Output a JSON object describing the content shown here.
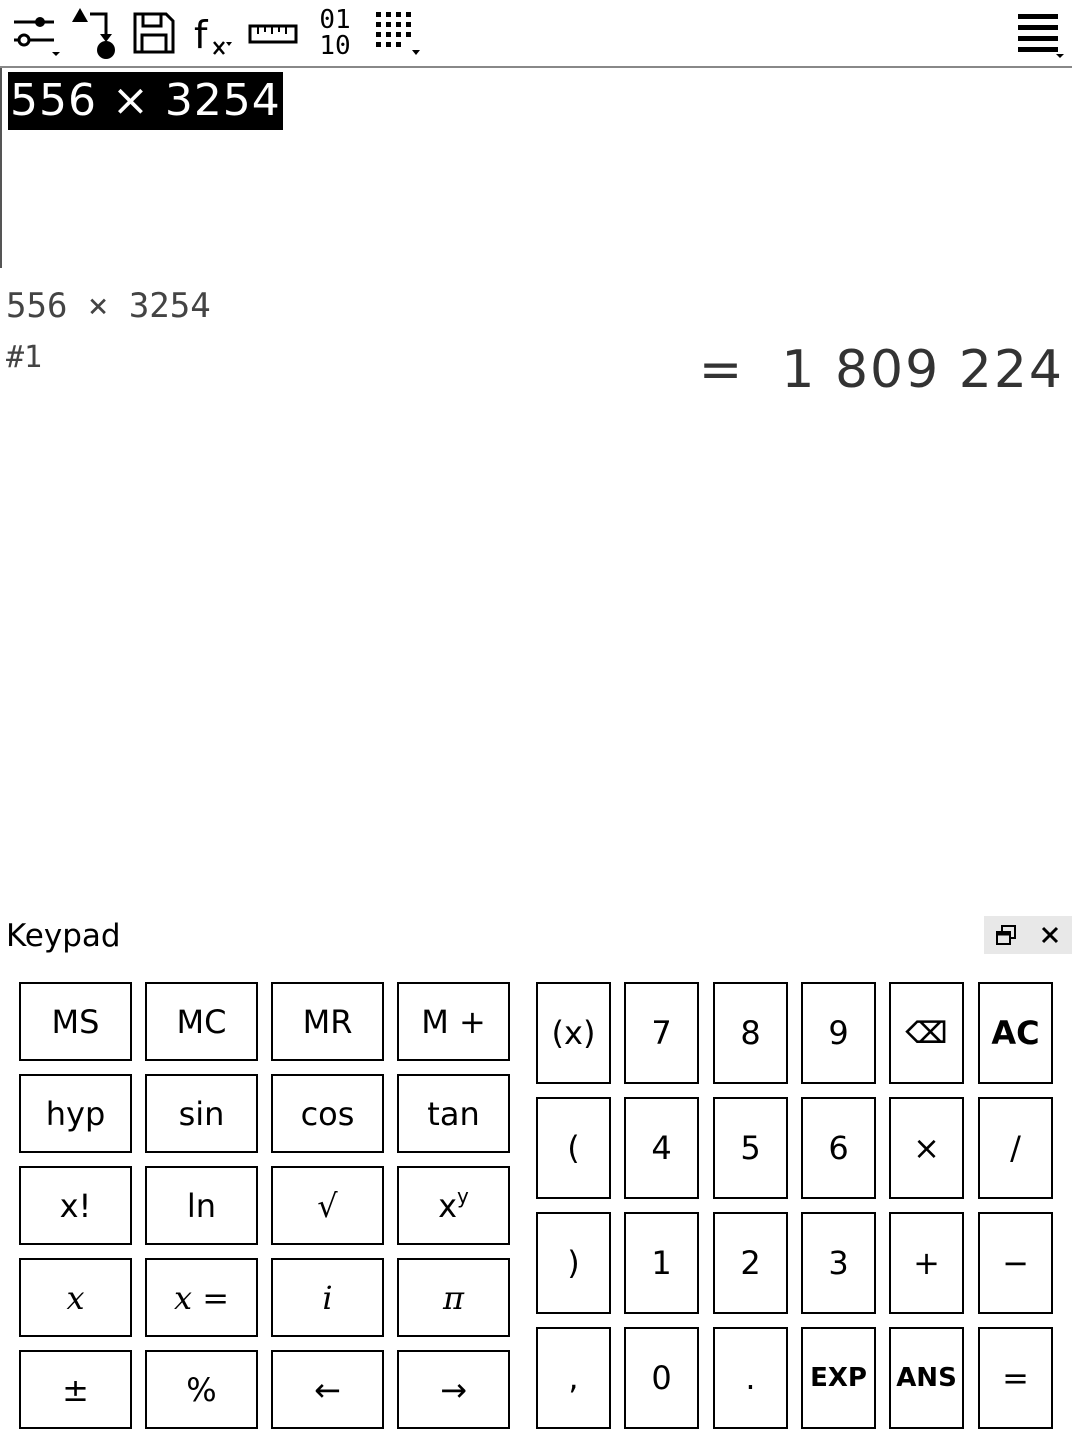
{
  "toolbar": {
    "icons": [
      "settings-sliders-icon",
      "variables-icon",
      "save-icon",
      "functions-icon",
      "units-icon",
      "number-base-icon",
      "keypad-grid-icon",
      "menu-icon"
    ],
    "base_top": "01",
    "base_bottom": "10",
    "fx_label": "f"
  },
  "editor": {
    "expression": "556 × 3254"
  },
  "history": {
    "expression": "556 × 3254",
    "index": "#1",
    "result": "=  1 809 224"
  },
  "keypad": {
    "title": "Keypad",
    "restore_icon": "restore-window-icon",
    "close_icon": "close-icon",
    "left_keys": [
      [
        "MS",
        "MC",
        "MR",
        "M +"
      ],
      [
        "hyp",
        "sin",
        "cos",
        "tan"
      ],
      [
        "x!",
        "ln",
        "√",
        "x"
      ],
      [
        "x",
        "x  =",
        "i",
        "π"
      ],
      [
        "±",
        "%",
        "←",
        "→"
      ]
    ],
    "power_sup": "y",
    "right_keys": [
      [
        "(x)",
        "7",
        "8",
        "9",
        "⌫",
        "AC"
      ],
      [
        "(",
        "4",
        "5",
        "6",
        "×",
        "/"
      ],
      [
        ")",
        "1",
        "2",
        "3",
        "+",
        "−"
      ],
      [
        ",",
        "0",
        ".",
        "EXP",
        "ANS",
        "="
      ]
    ]
  }
}
